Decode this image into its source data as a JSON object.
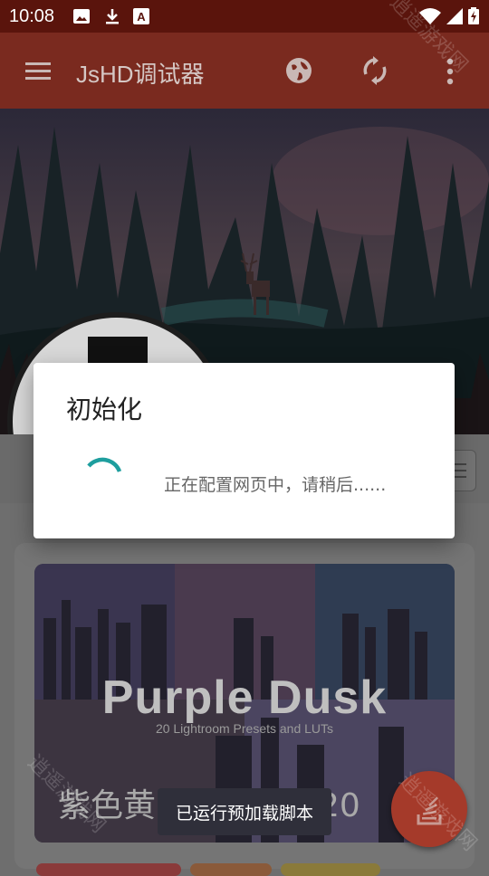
{
  "status_bar": {
    "time": "10:08",
    "icons": [
      "image-icon",
      "download-icon",
      "a-square-icon",
      "wifi-icon",
      "signal-icon",
      "battery-charging-icon"
    ]
  },
  "app_bar": {
    "title": "JsHD调试器",
    "icons": [
      "menu-icon",
      "globe-icon",
      "refresh-icon",
      "more-vert-icon"
    ]
  },
  "banner": {
    "headline": "Purple Dusk",
    "subheadline": "20 Lightroom Presets and LUTs",
    "caption_cn": "紫色黄昏滤镜预设20"
  },
  "dialog": {
    "title": "初始化",
    "message": "正在配置网页中，请稍后......"
  },
  "toast": {
    "text": "已运行预加载脚本"
  },
  "fab": {
    "icon": "stack-icon"
  },
  "watermark": {
    "text": "逍遥游戏网"
  },
  "colors": {
    "status_bar": "#5a140c",
    "app_bar": "#7a2a1f",
    "fab": "#a53a2a",
    "spinner": "#1e9e9e",
    "toast_bg": "#2f2f3a"
  }
}
